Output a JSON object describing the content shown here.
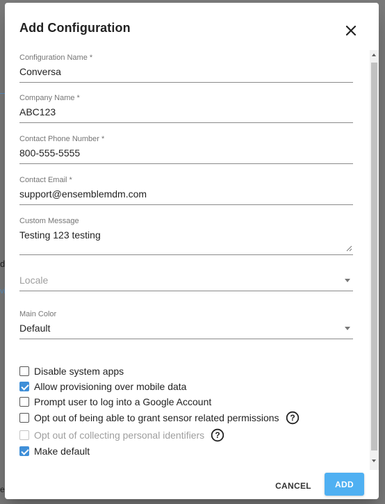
{
  "background": {
    "fragment_1": "d",
    "fragment_2": "vi",
    "fragment_3": "e"
  },
  "dialog": {
    "title": "Add Configuration",
    "close_icon": "close-icon"
  },
  "form": {
    "configuration_name": {
      "label": "Configuration Name *",
      "value": "Conversa"
    },
    "company_name": {
      "label": "Company Name *",
      "value": "ABC123"
    },
    "contact_phone": {
      "label": "Contact Phone Number *",
      "value": "800-555-5555"
    },
    "contact_email": {
      "label": "Contact Email *",
      "value": "support@ensemblemdm.com"
    },
    "custom_message": {
      "label": "Custom Message",
      "value": "Testing 123 testing"
    },
    "locale": {
      "placeholder": "Locale",
      "value": ""
    },
    "main_color": {
      "label": "Main Color",
      "value": "Default"
    }
  },
  "checkboxes": [
    {
      "label": "Disable system apps",
      "checked": false,
      "disabled": false,
      "help": false
    },
    {
      "label": "Allow provisioning over mobile data",
      "checked": true,
      "disabled": false,
      "help": false
    },
    {
      "label": "Prompt user to log into a Google Account",
      "checked": false,
      "disabled": false,
      "help": false
    },
    {
      "label": "Opt out of being able to grant sensor related permissions",
      "checked": false,
      "disabled": false,
      "help": true
    },
    {
      "label": "Opt out of collecting personal identifiers",
      "checked": false,
      "disabled": true,
      "help": true
    },
    {
      "label": "Make default",
      "checked": true,
      "disabled": false,
      "help": false
    }
  ],
  "actions": {
    "cancel_label": "CANCEL",
    "add_label": "ADD"
  },
  "colors": {
    "accent": "#4fb0f2",
    "checkbox_checked": "#3f8fd8",
    "overlay": "#7a7a7a"
  }
}
